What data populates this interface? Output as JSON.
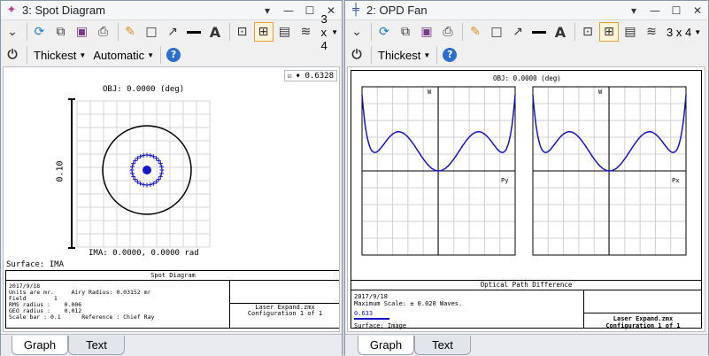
{
  "spot": {
    "title": "3: Spot Diagram",
    "toolbar": {
      "rows_cols": "3 x 4",
      "line_style": "Thickest",
      "scale_mode": "Automatic"
    },
    "overlay_value": "0.6328",
    "obj_label": "OBJ: 0.0000 (deg)",
    "scale_label": "0.10",
    "ima_label": "IMA: 0.0000, 0.0000 rad",
    "surface_label": "Surface: IMA",
    "info": {
      "title": "Spot Diagram",
      "date": "2017/9/18",
      "units": "Units are mr.",
      "airy": "Airy Radius: 0.03152 mr",
      "field_label": "Field",
      "field_value": "1",
      "rms_label": "RMS radius :",
      "rms_value": "0.006",
      "geo_label": "GEO radius :",
      "geo_value": "0.012",
      "scalebar_label": "Scale bar : 0.1",
      "reference": "Reference : Chief Ray",
      "file": "Laser Expand.zmx",
      "config": "Configuration 1 of 1"
    },
    "tabs": [
      "Graph",
      "Text"
    ]
  },
  "opd": {
    "title": "2: OPD Fan",
    "toolbar": {
      "rows_cols": "3 x 4",
      "line_style": "Thickest"
    },
    "obj_label": "OBJ: 0.0000 (deg)",
    "left_axis": {
      "y": "W",
      "x": "Py"
    },
    "right_axis": {
      "y": "W",
      "x": "Px"
    },
    "plot_title": "Optical Path Difference",
    "info": {
      "date": "2017/9/18",
      "scale": "Maximum Scale: ± 0.020 Waves.",
      "wavelength": "0.633",
      "surface": "Surface: Image",
      "file": "Laser Expand.zmx",
      "config": "Configuration 1 of 1"
    },
    "tabs": [
      "Graph",
      "Text"
    ],
    "line_color": "#1515c8"
  }
}
